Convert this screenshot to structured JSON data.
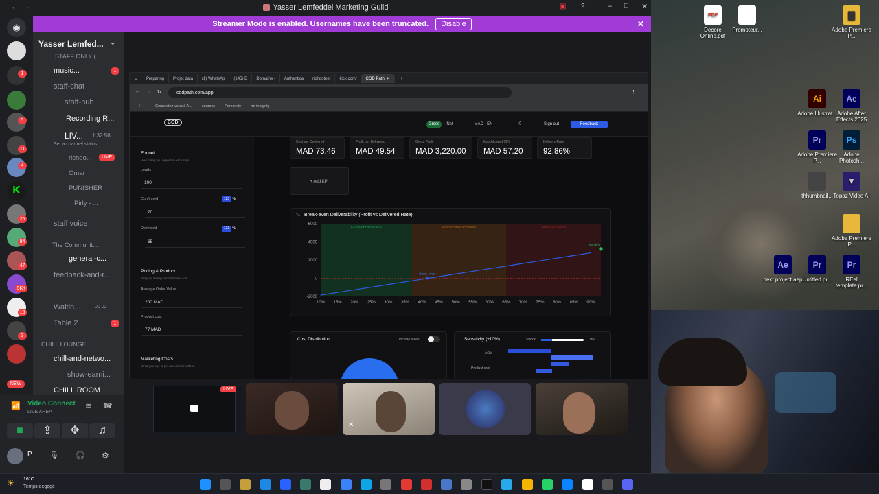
{
  "window": {
    "title": "Yasser Lemfeddel Marketing Guild"
  },
  "banner": {
    "text": "Streamer Mode is enabled. Usernames have been truncated.",
    "button": "Disable"
  },
  "server": {
    "name": "Yasser Lemfed...",
    "badges": [
      "1",
      "5",
      "11",
      "4",
      "26",
      "94",
      "47",
      "5K+",
      "16",
      "3",
      "NEW"
    ]
  },
  "channels": [
    {
      "label": "STAFF ONLY (...",
      "type": "cat"
    },
    {
      "label": "music...",
      "type": "voice",
      "badge": "1"
    },
    {
      "label": "staff-chat",
      "type": "text"
    },
    {
      "label": "staff-hub",
      "type": "text"
    },
    {
      "label": "Recording R...",
      "type": "text"
    },
    {
      "label": "LIV...",
      "type": "voice",
      "time": "1:32:56"
    },
    {
      "label": "Set a channel status",
      "type": "status"
    },
    {
      "label": "richdo...",
      "type": "user",
      "live": "LIVE"
    },
    {
      "label": "Omar",
      "type": "user"
    },
    {
      "label": "PUNISHER",
      "type": "user"
    },
    {
      "label": "Pirly - ...",
      "type": "user"
    },
    {
      "label": "staff voice",
      "type": "voice"
    },
    {
      "label": "The Communit...",
      "type": "cat"
    },
    {
      "label": "general-c...",
      "type": "text"
    },
    {
      "label": "feedback-and-r...",
      "type": "text"
    },
    {
      "label": "Waitin...",
      "type": "voice",
      "counts": "00 02"
    },
    {
      "label": "Table 2",
      "type": "voice",
      "badge": "1"
    },
    {
      "label": "CHILL LOUNGE",
      "type": "cat"
    },
    {
      "label": "chill-and-netwo...",
      "type": "text"
    },
    {
      "label": "show-earni...",
      "type": "text"
    },
    {
      "label": "CHILL ROOM",
      "type": "voice"
    }
  ],
  "voice_status": {
    "label": "Video Connect",
    "sub": "LIVE AREA",
    "user": "P..."
  },
  "browser": {
    "tabs": [
      "Preparing",
      "Projet data",
      "(1) WhatsAp",
      "(145) D",
      "Domains -",
      "Authentica",
      "richdotnet",
      "kick.com/",
      "COD Path"
    ],
    "url": "codpath.com/app",
    "bookmarks": [
      "Connectez-vous à A...",
      "courses",
      "Perplexity",
      "rm integrity"
    ]
  },
  "app": {
    "logo": "COD",
    "nav": {
      "gross": "Gross",
      "net": "Net",
      "lang": "MAD - EN",
      "signout": "Sign out",
      "feedback": "Feedback"
    },
    "funnel": {
      "title": "Funnel",
      "sub": "How many you expect at each step.",
      "leads_label": "Leads",
      "leads": "100",
      "confirmed_label": "Confirmed",
      "confirmed": "70",
      "confirmed_pct": "123",
      "delivered_label": "Delivered",
      "delivered": "65",
      "delivered_pct": "123",
      "pct_sign": "%"
    },
    "pricing": {
      "title": "Pricing & Product",
      "sub": "Set your selling price and unit cost.",
      "aov_label": "Average Order Value",
      "aov": "200 MAD",
      "cost_label": "Product cost",
      "cost": "77 MAD"
    },
    "marketing": {
      "title": "Marketing Costs",
      "sub": "What you pay to get and deliver orders."
    },
    "kpis": [
      {
        "title": "Cost per Delivered",
        "value": "MAD 73.46"
      },
      {
        "title": "Profit per Delivered",
        "value": "MAD 49.54"
      },
      {
        "title": "Gross Profit",
        "value": "MAD 3,220.00"
      },
      {
        "title": "Max Allowed CPL",
        "value": "MAD 57.20"
      },
      {
        "title": "Delivery Rate",
        "value": "92.86%"
      }
    ],
    "add_kpi": "Add KPI",
    "cost_dist": {
      "title": "Cost Distribution",
      "toggle": "Include taxes"
    },
    "sensitivity": {
      "title": "Sensitivity (±10%)",
      "shock": "Shock",
      "shock_val": "10%",
      "rows": [
        "AOV",
        "Product cost"
      ]
    }
  },
  "chart_data": {
    "type": "line",
    "title": "Break-even Deliverability (Profit vs Delivered Rate)",
    "zones": [
      "Excellent scenario",
      "Predictable scenario",
      "Risky scenario"
    ],
    "marker_labels": [
      "Break-even",
      "You're h"
    ],
    "x": [
      10,
      15,
      20,
      25,
      30,
      35,
      40,
      45,
      50,
      55,
      60,
      65,
      70,
      75,
      80,
      85,
      90
    ],
    "xticks": [
      "10%",
      "15%",
      "20%",
      "25%",
      "30%",
      "35%",
      "40%",
      "45%",
      "50%",
      "55%",
      "60%",
      "65%",
      "70%",
      "75%",
      "80%",
      "85%",
      "90%"
    ],
    "yticks": [
      "6000",
      "4000",
      "2000",
      "0",
      "-2000"
    ],
    "ylim": [
      -2000,
      6000
    ],
    "series": [
      {
        "values": [
          -1850,
          -1560,
          -1270,
          -980,
          -690,
          -400,
          -110,
          180,
          470,
          760,
          1050,
          1340,
          1630,
          1920,
          2210,
          2500,
          2790
        ]
      }
    ],
    "current_point": {
      "x": 93,
      "y": 3220
    },
    "break_even_x": 41.5
  },
  "taskbar": {
    "weather_temp": "16°C",
    "weather_desc": "Temps dégagé"
  },
  "desktop": {
    "icons": [
      "Decore Online.pdf",
      "Promoteur...",
      "Adobe Premiere P...",
      "Adobe Illustrat...",
      "Adobe After Effects 2025",
      "Adobe Premiere P...",
      "Adobe Photosh...",
      "thhumbnail...",
      "Topaz Video AI",
      "Adobe Premiere P...",
      "next project.aep",
      "Untitled.pr...",
      "REel template.pr..."
    ]
  },
  "calls": {
    "live": "LIVE"
  }
}
